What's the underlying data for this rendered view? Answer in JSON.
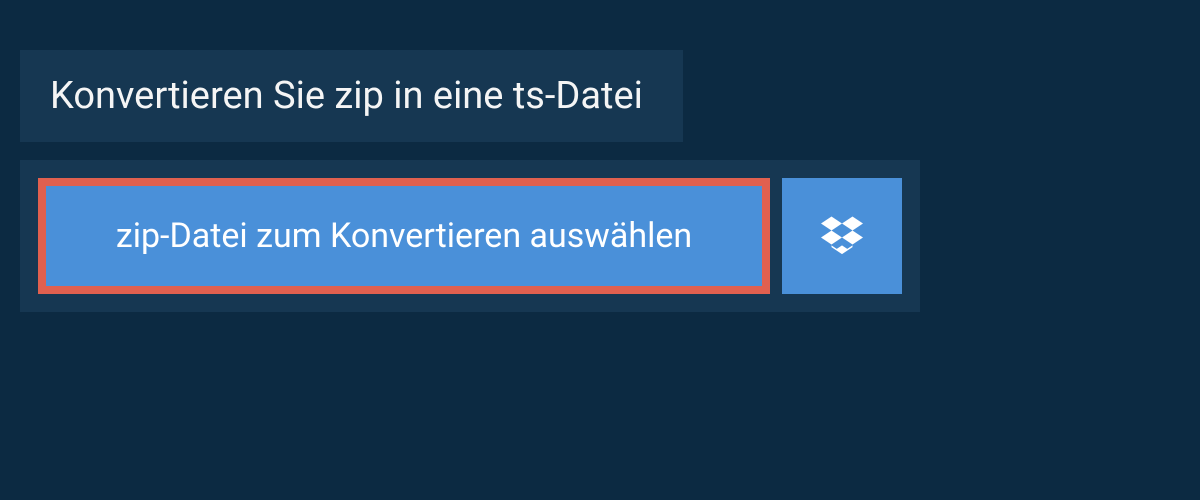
{
  "header": {
    "title": "Konvertieren Sie zip in eine ts-Datei"
  },
  "upload": {
    "select_file_label": "zip-Datei zum Konvertieren auswählen"
  }
}
